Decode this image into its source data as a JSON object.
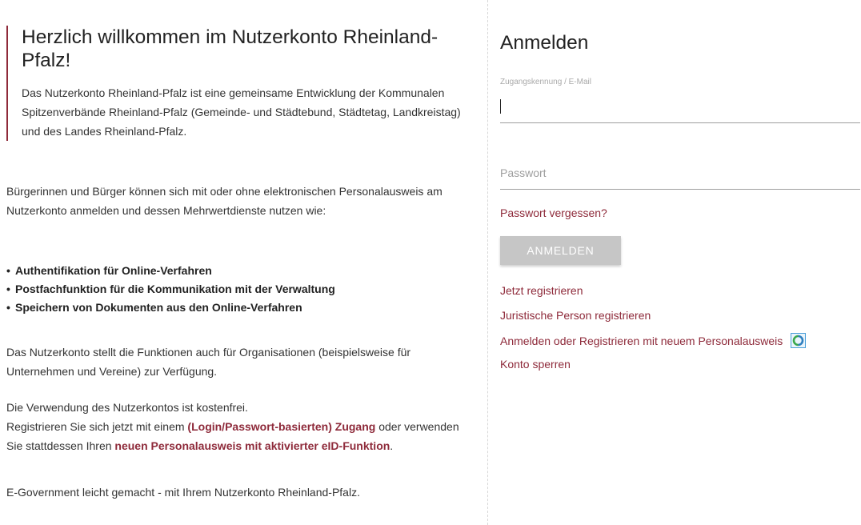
{
  "intro": {
    "title": "Herzlich willkommen im Nutzerkonto Rheinland-Pfalz!",
    "text": "Das Nutzerkonto Rheinland-Pfalz ist eine gemeinsame Entwicklung der Kommunalen Spitzenverbände Rheinland-Pfalz (Gemeinde- und Städtebund, Städtetag, Landkreistag) und des Landes Rheinland-Pfalz."
  },
  "paragraph1": "Bürgerinnen und Bürger können sich mit oder ohne elektronischen Personalausweis am Nutzerkonto anmelden und dessen Mehrwertdienste nutzen wie:",
  "features": [
    "Authentifikation für Online-Verfahren",
    "Postfachfunktion für die Kommunikation mit der Verwaltung",
    "Speichern von Dokumenten aus den Online-Verfahren"
  ],
  "bullet": "•",
  "paragraph2": "Das Nutzerkonto stellt die Funktionen auch für Organisationen (beispielsweise für Unternehmen und Vereine) zur Verfügung.",
  "paragraph3": {
    "line1": "Die Verwendung des Nutzerkontos ist kostenfrei.",
    "part1": "Registrieren Sie sich jetzt mit einem ",
    "link1": "(Login/Passwort-basierten) Zugang",
    "part2": " oder verwenden Sie stattdessen Ihren ",
    "link2": "neuen Personalausweis mit aktivierter eID-Funktion",
    "part3": "."
  },
  "paragraph4": "E-Government leicht gemacht - mit Ihrem Nutzerkonto Rheinland-Pfalz.",
  "login": {
    "title": "Anmelden",
    "username_label": "Zugangskennung / E-Mail",
    "username_value": "",
    "password_placeholder": "Passwort",
    "password_value": "",
    "forgot_password": "Passwort vergessen?",
    "submit": "ANMELDEN",
    "links": {
      "register": "Jetzt registrieren",
      "register_legal": "Juristische Person registrieren",
      "eid": "Anmelden oder Registrieren mit neuem Personalausweis",
      "lock": "Konto sperren"
    },
    "eid_icon": "eid-icon"
  },
  "colors": {
    "accent": "#8e2a3a",
    "button_disabled": "#c6c6c6",
    "eid_icon_border": "#4a9fd8",
    "eid_icon_ring": "#3aa84b"
  }
}
